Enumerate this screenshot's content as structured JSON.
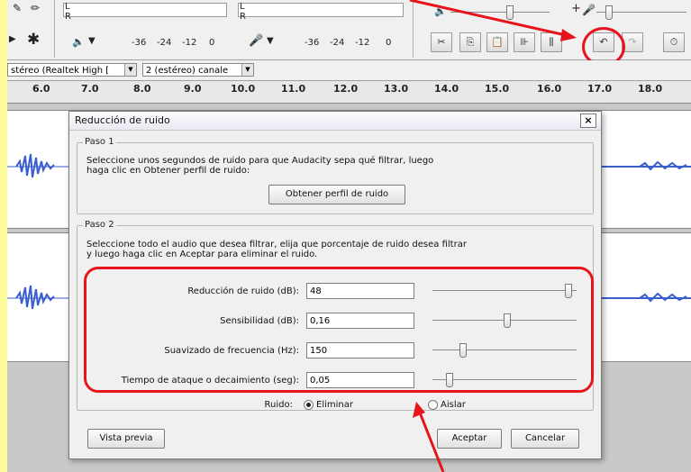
{
  "toolbar": {
    "meter_l": "L",
    "meter_r": "R",
    "scale": [
      "-36",
      "-24",
      "-12",
      "0"
    ],
    "scale2": [
      "-36",
      "-24",
      "-12",
      "0"
    ],
    "plus": "+"
  },
  "devices": {
    "output_device": "stéreo (Realtek High [",
    "channels": "2 (estéreo) canale"
  },
  "ruler": {
    "ticks": [
      "6.0",
      "7.0",
      "8.0",
      "9.0",
      "10.0",
      "11.0",
      "12.0",
      "13.0",
      "14.0",
      "15.0",
      "16.0",
      "17.0",
      "18.0"
    ]
  },
  "dialog": {
    "title": "Reducción de ruido",
    "close": "×",
    "step1": {
      "legend": "Paso 1",
      "text1": "Seleccione unos segundos de ruido para que Audacity sepa qué filtrar, luego",
      "text2": "haga clic en Obtener perfil de ruido:",
      "button": "Obtener perfil de ruido"
    },
    "step2": {
      "legend": "Paso 2",
      "text1": "Seleccione todo el audio que desea filtrar, elija que porcentaje de ruido desea filtrar",
      "text2": "y luego haga clic en Aceptar para eliminar el ruido.",
      "params": [
        {
          "label": "Reducción de ruido (dB):",
          "value": "48",
          "slider": 0.97
        },
        {
          "label": "Sensibilidad (dB):",
          "value": "0,16",
          "slider": 0.52
        },
        {
          "label": "Suavizado de frecuencia (Hz):",
          "value": "150",
          "slider": 0.2
        },
        {
          "label": "Tiempo de ataque o decaimiento (seg):",
          "value": "0,05",
          "slider": 0.1
        }
      ]
    },
    "noise_label": "Ruido:",
    "options": [
      "Eliminar",
      "Aislar"
    ],
    "preview": "Vista previa",
    "accept": "Aceptar",
    "cancel": "Cancelar"
  },
  "colors": {
    "highlight": "#e8141b",
    "background": "#fefb9a",
    "waveform": "#3a5fcd"
  }
}
